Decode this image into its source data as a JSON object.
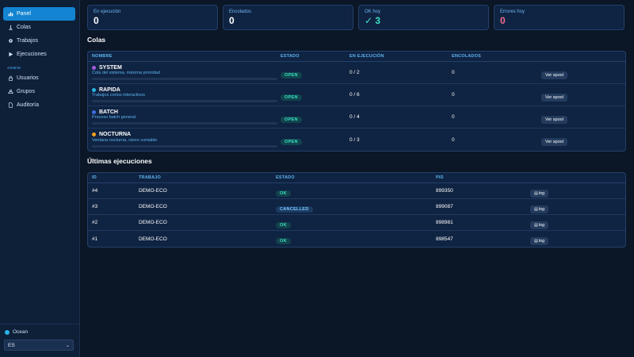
{
  "sidebar": {
    "nav": [
      {
        "label": "Panel",
        "icon": "bar-chart-icon",
        "active": true
      },
      {
        "label": "Colas",
        "icon": "queue-icon"
      },
      {
        "label": "Trabajos",
        "icon": "gear-icon"
      },
      {
        "label": "Ejecuciones",
        "icon": "play-icon"
      }
    ],
    "admin_label": "ADMIN",
    "admin": [
      {
        "label": "Usuarios",
        "icon": "lock-icon"
      },
      {
        "label": "Grupos",
        "icon": "users-icon"
      },
      {
        "label": "Auditoría",
        "icon": "document-icon"
      }
    ],
    "theme": "Ocean",
    "language": "ES"
  },
  "stats": [
    {
      "label": "En ejecución",
      "value": "0"
    },
    {
      "label": "Encolados",
      "value": "0"
    },
    {
      "label": "OK hoy",
      "value": "✓ 3"
    },
    {
      "label": "Errores hoy",
      "value": "0"
    }
  ],
  "queues": {
    "title": "Colas",
    "headers": [
      "NOMBRE",
      "ESTADO",
      "EN EJECUCIÓN",
      "ENCOLADOS"
    ],
    "rows": [
      {
        "name": "SYSTEM",
        "desc": "Cola del sistema, máxima prioridad",
        "color": "#a45ae0",
        "status": "OPEN",
        "running": "0 / 2",
        "queued": "0",
        "action": "Ver spool",
        "load": 0
      },
      {
        "name": "RAPIDA",
        "desc": "Trabajos cortos interactivos",
        "color": "#2ab4e6",
        "status": "OPEN",
        "running": "0 / 6",
        "queued": "0",
        "action": "Ver spool",
        "load": 0
      },
      {
        "name": "BATCH",
        "desc": "Proceso batch general",
        "color": "#3d6ee0",
        "status": "OPEN",
        "running": "0 / 4",
        "queued": "0",
        "action": "Ver spool",
        "load": 0
      },
      {
        "name": "NOCTURNA",
        "desc": "Ventana nocturna, cierre contable",
        "color": "#f0a020",
        "status": "OPEN",
        "running": "0 / 3",
        "queued": "0",
        "action": "Ver spool",
        "load": 0
      }
    ]
  },
  "executions": {
    "title": "Últimas ejecuciones",
    "headers": [
      "ID",
      "TRABAJO",
      "ESTADO",
      "PID"
    ],
    "rows": [
      {
        "id": "#4",
        "job": "DEMO-ECO",
        "status": "OK",
        "pid": "899350",
        "action": "log"
      },
      {
        "id": "#3",
        "job": "DEMO-ECO",
        "status": "CANCELLED",
        "pid": "899087",
        "action": "log"
      },
      {
        "id": "#2",
        "job": "DEMO-ECO",
        "status": "OK",
        "pid": "898981",
        "action": "log"
      },
      {
        "id": "#1",
        "job": "DEMO-ECO",
        "status": "OK",
        "pid": "898547",
        "action": "log"
      }
    ]
  }
}
